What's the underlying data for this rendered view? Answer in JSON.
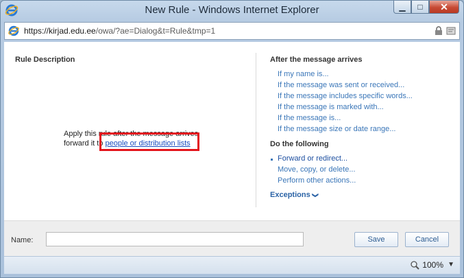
{
  "window": {
    "title": "New Rule - Windows Internet Explorer",
    "minimize_glyph": "▁",
    "maximize_glyph": "□",
    "close_glyph": "✕"
  },
  "address": {
    "host": "https://kirjad.edu.ee",
    "path": "/owa/?ae=Dialog&t=Rule&tmp=1"
  },
  "left": {
    "title": "Rule Description",
    "line1": "Apply this rule after the message arrives",
    "line2_prefix": "forward it to ",
    "link": "people or distribution lists"
  },
  "conditions": {
    "title": "After the message arrives",
    "items": [
      "If my name is...",
      "If the message was sent or received...",
      "If the message includes specific words...",
      "If the message is marked with...",
      "If the message is...",
      "If the message size or date range..."
    ]
  },
  "actions": {
    "title": "Do the following",
    "items": [
      "Forward or redirect...",
      "Move, copy, or delete...",
      "Perform other actions..."
    ]
  },
  "exceptions": {
    "label": "Exceptions",
    "caret": "❯"
  },
  "footer": {
    "name_label": "Name:",
    "name_value": "",
    "save_label": "Save",
    "cancel_label": "Cancel"
  },
  "status": {
    "zoom": "100%",
    "zoom_caret": "▼"
  },
  "colors": {
    "link": "#3a76b8",
    "highlight": "#e3141b"
  }
}
